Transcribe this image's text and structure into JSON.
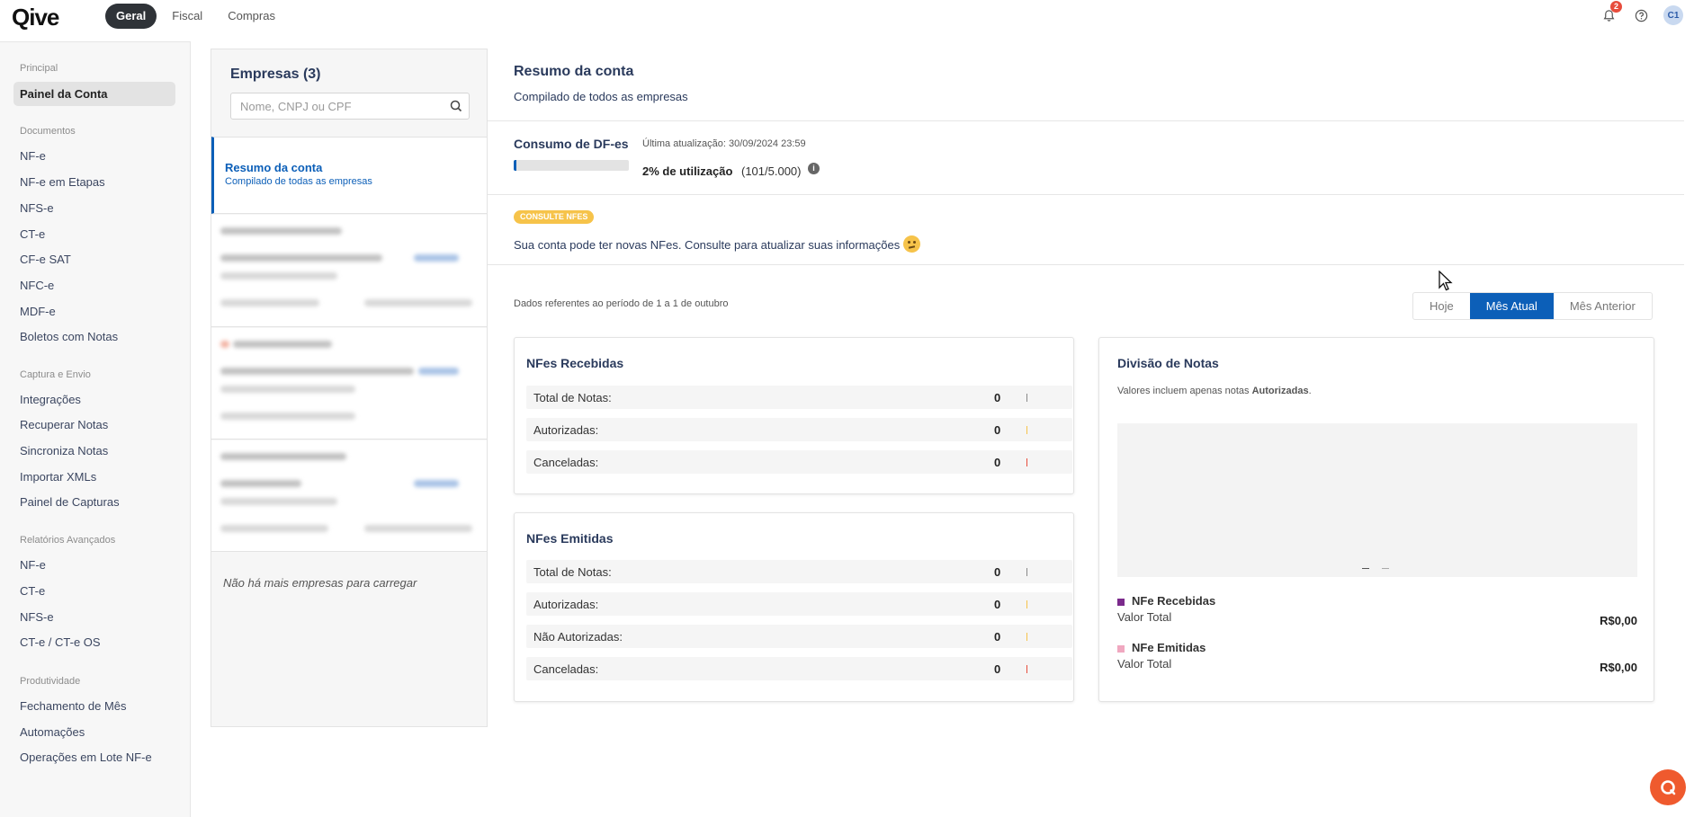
{
  "app": {
    "logo": "Qive",
    "tabs": [
      {
        "label": "Geral",
        "active": true
      },
      {
        "label": "Fiscal",
        "active": false
      },
      {
        "label": "Compras",
        "active": false
      }
    ],
    "notification_count": "2",
    "avatar_initials": "C1"
  },
  "sidebar": {
    "sections": [
      {
        "title": "Principal",
        "items": [
          "Painel da Conta"
        ]
      },
      {
        "title": "Documentos",
        "items": [
          "NF-e",
          "NF-e em Etapas",
          "NFS-e",
          "CT-e",
          "CF-e SAT",
          "NFC-e",
          "MDF-e",
          "Boletos com Notas"
        ]
      },
      {
        "title": "Captura e Envio",
        "items": [
          "Integrações",
          "Recuperar Notas",
          "Sincroniza Notas",
          "Importar XMLs",
          "Painel de Capturas"
        ]
      },
      {
        "title": "Relatórios Avançados",
        "items": [
          "NF-e",
          "CT-e",
          "NFS-e",
          "CT-e / CT-e OS"
        ]
      },
      {
        "title": "Produtividade",
        "items": [
          "Fechamento de Mês",
          "Automações",
          "Operações em Lote NF-e"
        ]
      }
    ],
    "active_item": "Painel da Conta"
  },
  "companies": {
    "title": "Empresas (3)",
    "search_placeholder": "Nome, CNPJ ou CPF",
    "selected": {
      "title": "Resumo da conta",
      "subtitle": "Compilado de todas as empresas"
    },
    "end_message": "Não há mais empresas para carregar"
  },
  "summary": {
    "title": "Resumo da conta",
    "subtitle": "Compilado de todos as empresas",
    "consumo_title": "Consumo de DF-es",
    "last_update": "Última atualização: 30/09/2024 23:59",
    "usage_fraction": 0.02,
    "usage_pct": "2% de utilização",
    "usage_count": "(101/5.000)",
    "consult_tag": "CONSULTE NFES",
    "consult_text": "Sua conta pode ter novas NFes. Consulte para atualizar suas informações",
    "period": "Dados referentes ao período de 1 a 1 de outubro",
    "period_tabs": [
      {
        "label": "Hoje",
        "active": false
      },
      {
        "label": "Mês Atual",
        "active": true
      },
      {
        "label": "Mês Anterior",
        "active": false
      }
    ]
  },
  "received": {
    "title": "NFes Recebidas",
    "rows": [
      {
        "label": "Total de Notas:",
        "value": "0",
        "color": "#888888"
      },
      {
        "label": "Autorizadas:",
        "value": "0",
        "color": "#f6c34a"
      },
      {
        "label": "Canceladas:",
        "value": "0",
        "color": "#e74c3c"
      }
    ]
  },
  "emitted": {
    "title": "NFes Emitidas",
    "rows": [
      {
        "label": "Total de Notas:",
        "value": "0",
        "color": "#888888"
      },
      {
        "label": "Autorizadas:",
        "value": "0",
        "color": "#f6c34a"
      },
      {
        "label": "Não Autorizadas:",
        "value": "0",
        "color": "#f6c34a"
      },
      {
        "label": "Canceladas:",
        "value": "0",
        "color": "#e74c3c"
      }
    ]
  },
  "division": {
    "title": "Divisão de Notas",
    "subtitle_pre": "Valores incluem apenas notas ",
    "subtitle_bold": "Autorizadas",
    "subtitle_post": ".",
    "legend": [
      {
        "name": "NFe Recebidas",
        "label": "Valor Total",
        "value": "R$0,00",
        "color": "#7b2a8c"
      },
      {
        "name": "NFe Emitidas",
        "label": "Valor Total",
        "value": "R$0,00",
        "color": "#f0a8c0"
      }
    ]
  },
  "colors": {
    "accent": "#0c5fb8",
    "title": "#2a3a5c",
    "tag": "#f6c34a",
    "chat": "#ef5a2e"
  }
}
